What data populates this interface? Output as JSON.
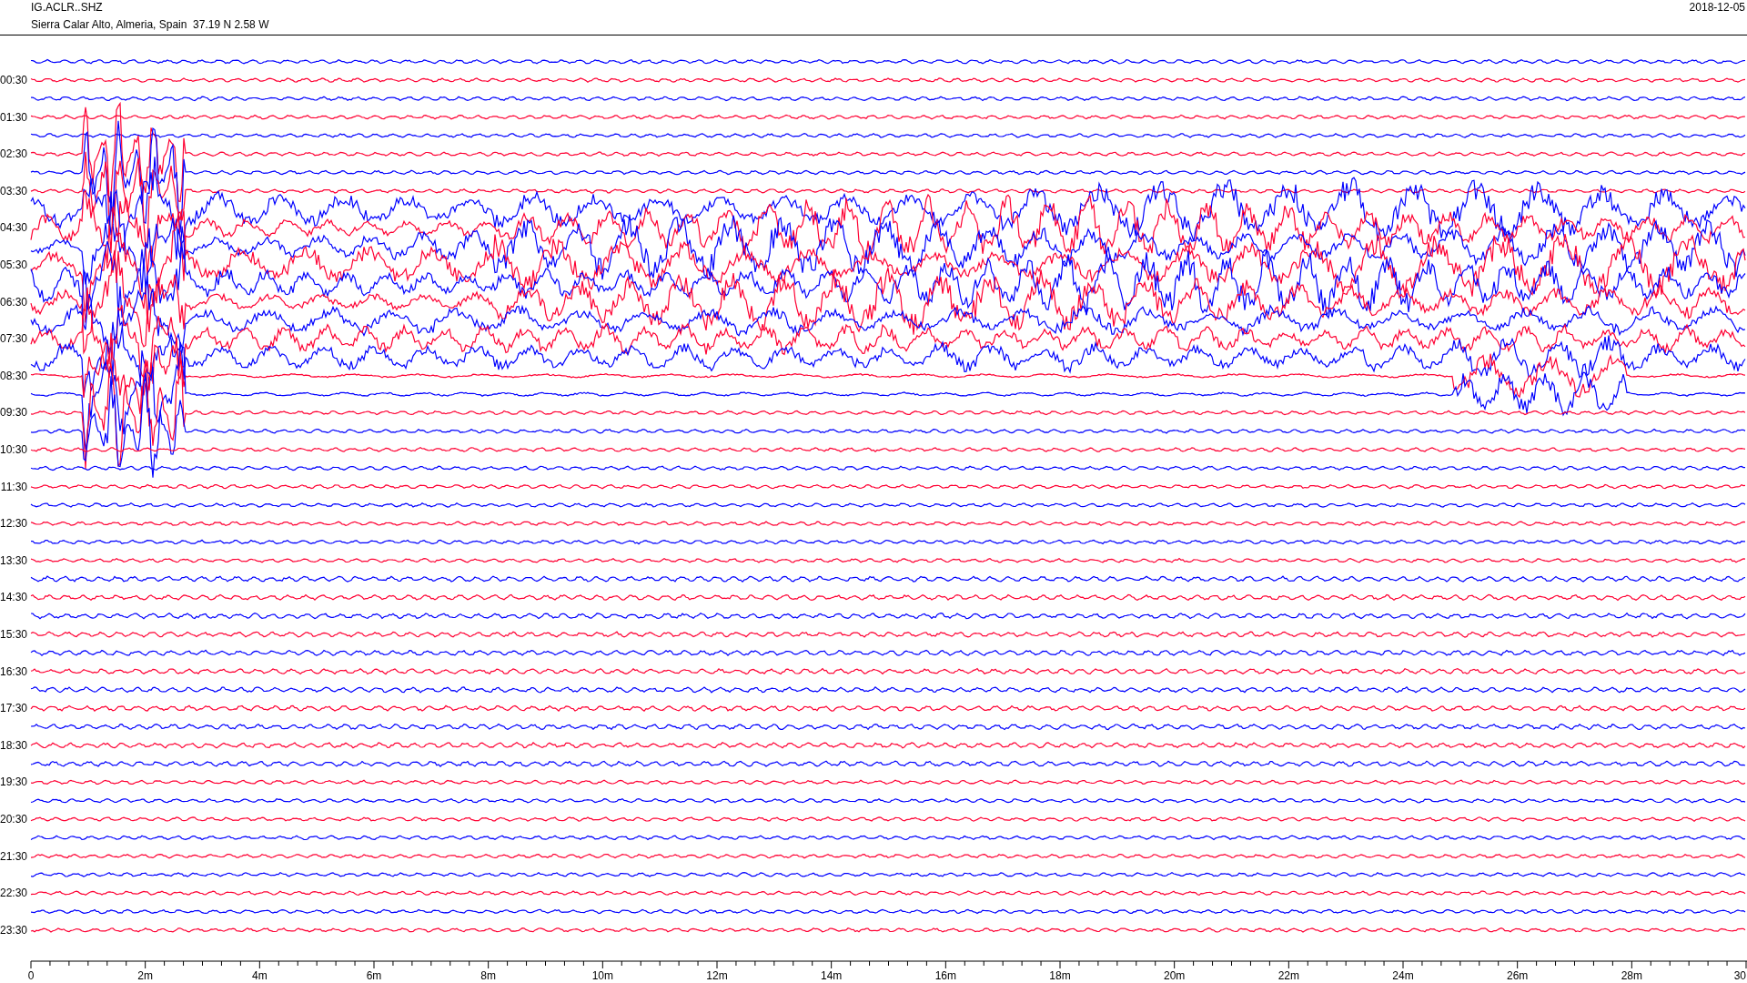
{
  "header": {
    "station": "IG.ACLR..SHZ",
    "location": "Sierra Calar Alto, Almeria, Spain  37.19 N 2.58 W",
    "date": "2018-12-05"
  },
  "rows": [
    {
      "color": "#0000ff"
    },
    {
      "label": "00:30",
      "color": "#ff0033"
    },
    {
      "color": "#0000ff"
    },
    {
      "label": "01:30",
      "color": "#ff0033"
    },
    {
      "color": "#0000ff"
    },
    {
      "label": "02:30",
      "color": "#ff0033"
    },
    {
      "color": "#0000ff"
    },
    {
      "label": "03:30",
      "color": "#ff0033"
    },
    {
      "color": "#0000ff"
    },
    {
      "label": "04:30",
      "color": "#ff0033"
    },
    {
      "color": "#0000ff"
    },
    {
      "label": "05:30",
      "color": "#ff0033"
    },
    {
      "color": "#0000ff"
    },
    {
      "label": "06:30",
      "color": "#ff0033"
    },
    {
      "color": "#0000ff"
    },
    {
      "label": "07:30",
      "color": "#ff0033"
    },
    {
      "color": "#0000ff"
    },
    {
      "label": "08:30",
      "color": "#ff0033"
    },
    {
      "color": "#0000ff"
    },
    {
      "label": "09:30",
      "color": "#ff0033"
    },
    {
      "color": "#0000ff"
    },
    {
      "label": "10:30",
      "color": "#ff0033"
    },
    {
      "color": "#0000ff"
    },
    {
      "label": "11:30",
      "color": "#ff0033"
    },
    {
      "color": "#0000ff"
    },
    {
      "label": "12:30",
      "color": "#ff0033"
    },
    {
      "color": "#0000ff"
    },
    {
      "label": "13:30",
      "color": "#ff0033"
    },
    {
      "color": "#0000ff"
    },
    {
      "label": "14:30",
      "color": "#ff0033"
    },
    {
      "color": "#0000ff"
    },
    {
      "label": "15:30",
      "color": "#ff0033"
    },
    {
      "color": "#0000ff"
    },
    {
      "label": "16:30",
      "color": "#ff0033"
    },
    {
      "color": "#0000ff"
    },
    {
      "label": "17:30",
      "color": "#ff0033"
    },
    {
      "color": "#0000ff"
    },
    {
      "label": "18:30",
      "color": "#ff0033"
    },
    {
      "color": "#0000ff"
    },
    {
      "label": "19:30",
      "color": "#ff0033"
    },
    {
      "color": "#0000ff"
    },
    {
      "label": "20:30",
      "color": "#ff0033"
    },
    {
      "color": "#0000ff"
    },
    {
      "label": "21:30",
      "color": "#ff0033"
    },
    {
      "color": "#0000ff"
    },
    {
      "label": "22:30",
      "color": "#ff0033"
    },
    {
      "color": "#0000ff"
    },
    {
      "label": "23:30",
      "color": "#ff0033"
    }
  ],
  "x_axis": {
    "labels": [
      "0",
      "2m",
      "4m",
      "6m",
      "8m",
      "10m",
      "12m",
      "14m",
      "16m",
      "18m",
      "20m",
      "22m",
      "24m",
      "26m",
      "28m",
      "30"
    ]
  }
}
